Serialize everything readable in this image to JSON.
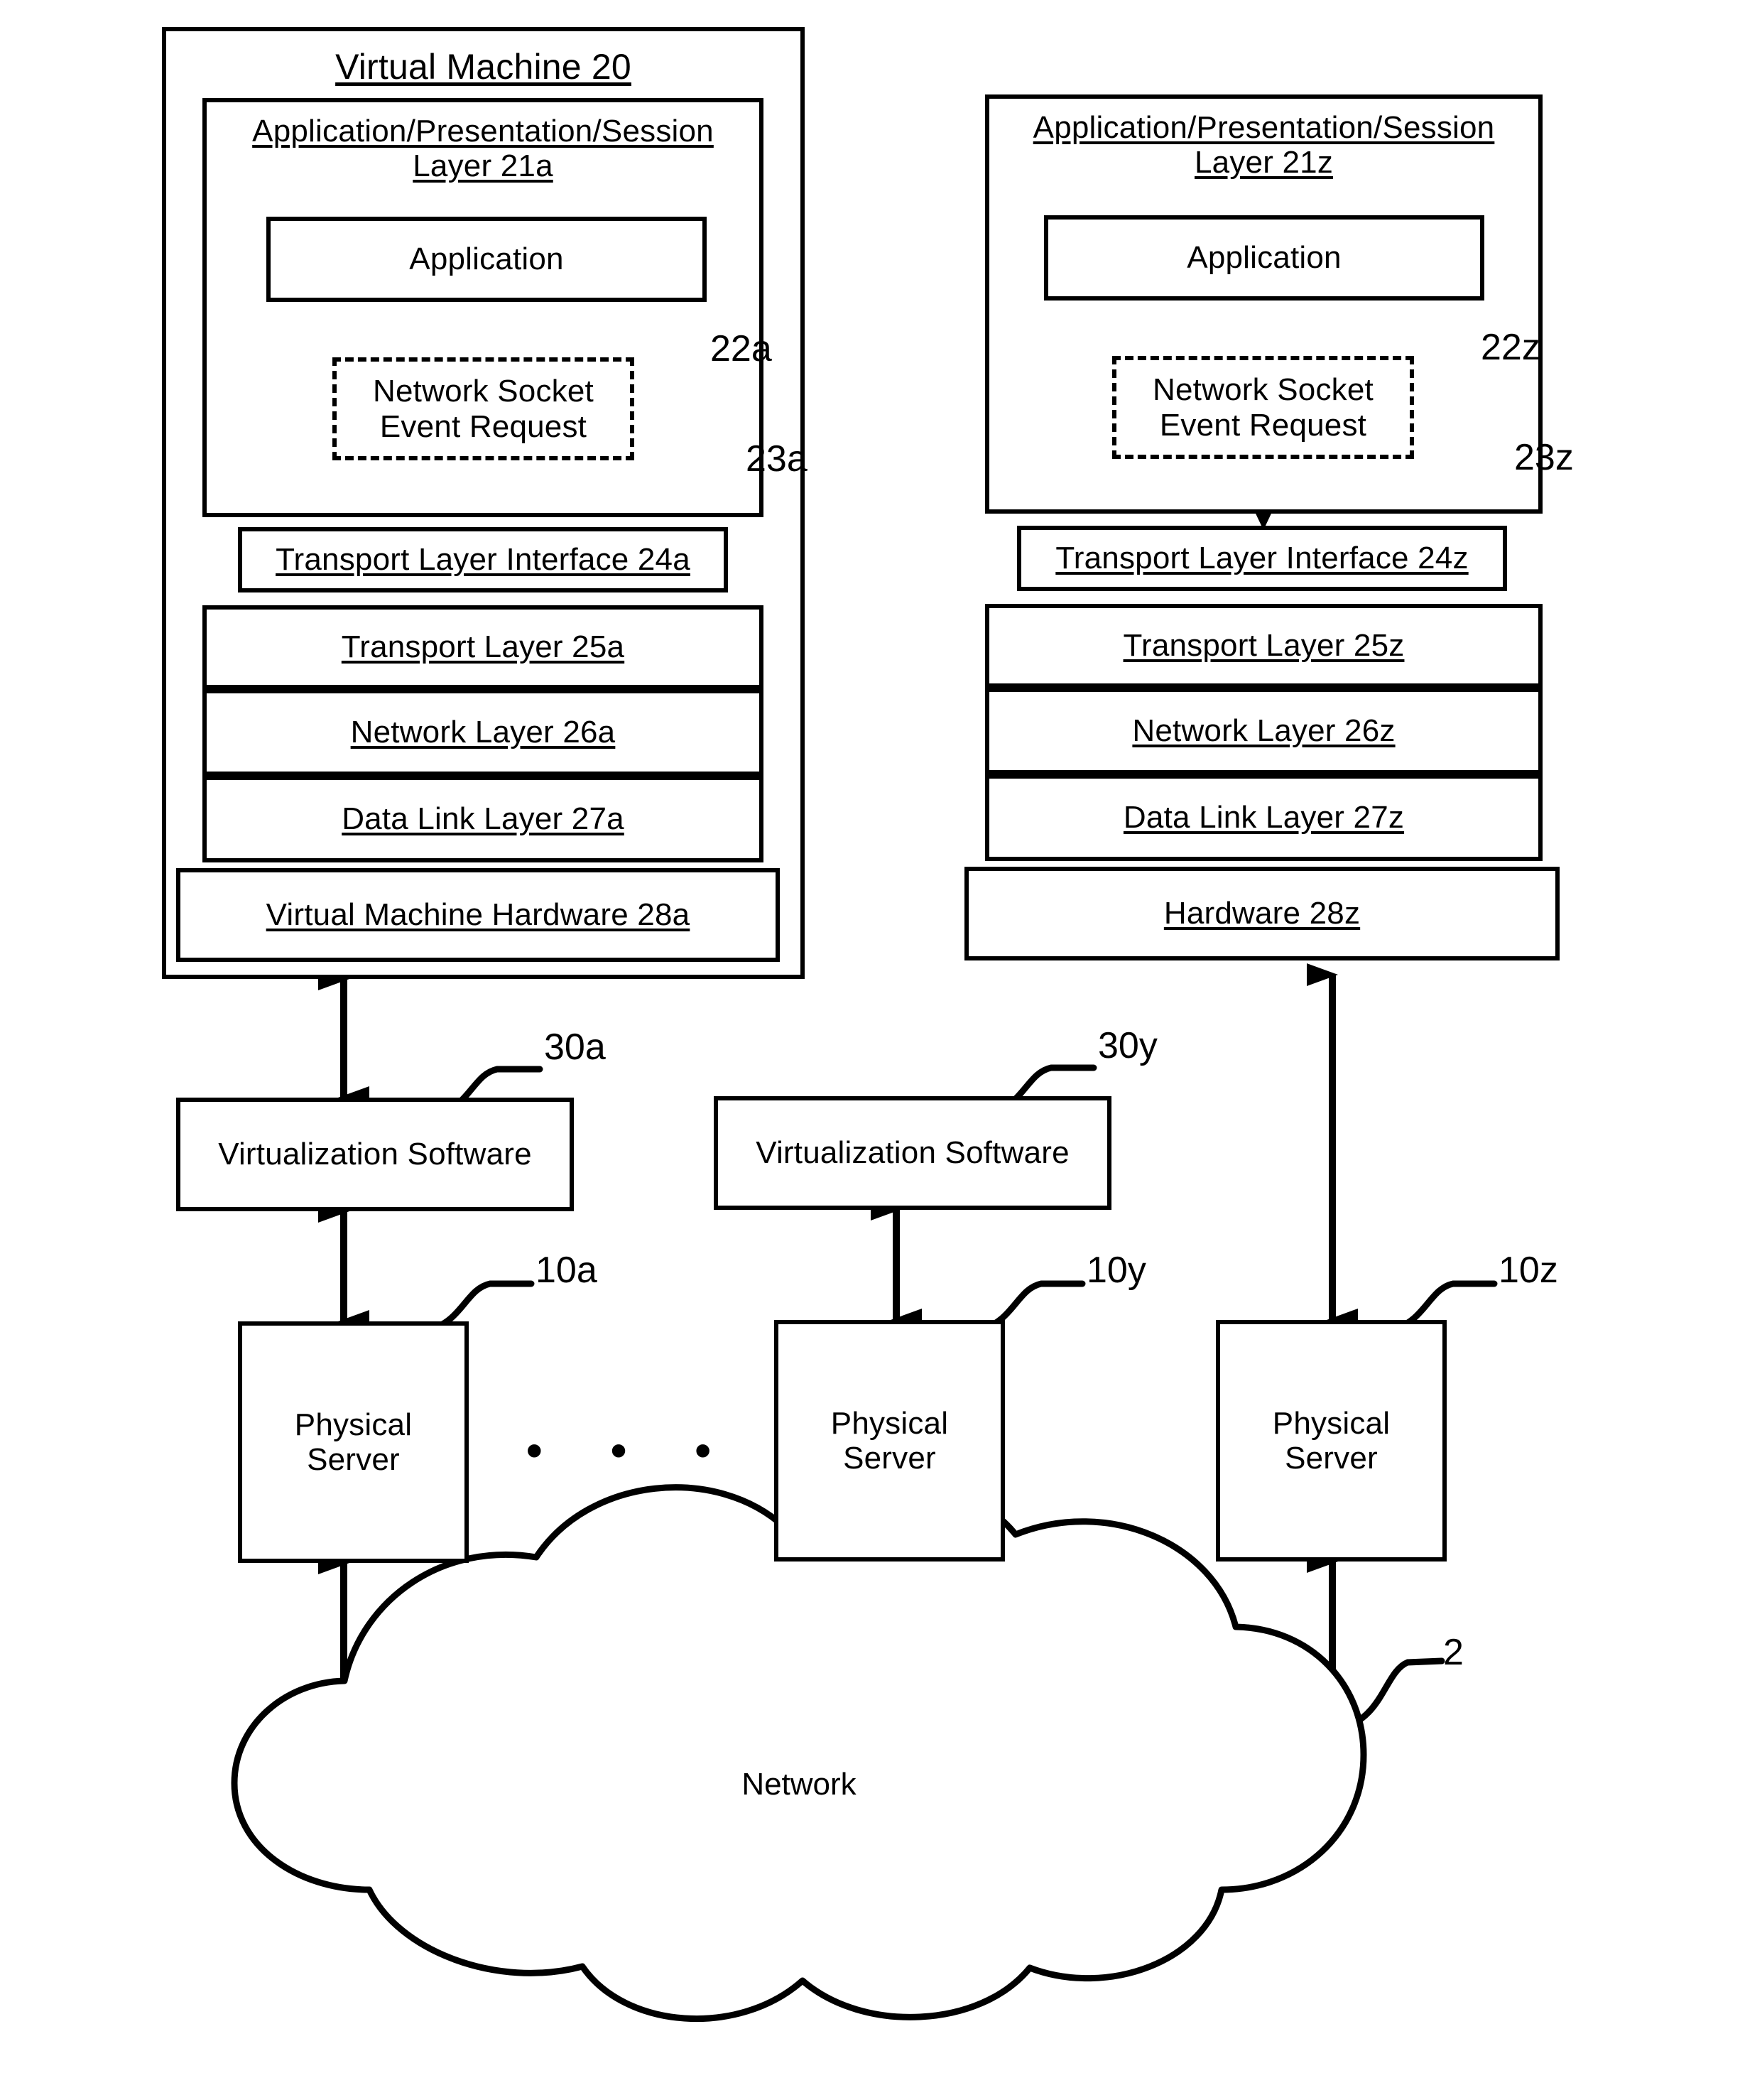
{
  "figure": {
    "title": "Virtual machine network stack and physical server topology"
  },
  "left_stack": {
    "vm_title": "Virtual Machine 20",
    "session_layer": "Application/Presentation/Session\nLayer 21a",
    "application": "Application",
    "socket_request": "Network Socket\nEvent Request",
    "transport_interface": "Transport Layer Interface 24a",
    "transport_layer": "Transport Layer 25a",
    "network_layer": "Network Layer 26a",
    "data_link_layer": "Data Link Layer 27a",
    "hardware": "Virtual Machine Hardware 28a",
    "callout_app": "22a",
    "callout_socket": "23a"
  },
  "right_stack": {
    "session_layer": "Application/Presentation/Session\nLayer 21z",
    "application": "Application",
    "socket_request": "Network Socket\nEvent Request",
    "transport_interface": "Transport Layer Interface 24z",
    "transport_layer": "Transport Layer 25z",
    "network_layer": "Network Layer 26z",
    "data_link_layer": "Data Link Layer 27z",
    "hardware": "Hardware 28z",
    "callout_app": "22z",
    "callout_socket": "23z"
  },
  "virtualization": {
    "left_label": "Virtualization Software",
    "left_callout": "30a",
    "middle_label": "Virtualization Software",
    "middle_callout": "30y"
  },
  "servers": {
    "left_label": "Physical\nServer",
    "left_callout": "10a",
    "middle_label": "Physical\nServer",
    "middle_callout": "10y",
    "right_label": "Physical\nServer",
    "right_callout": "10z",
    "ellipsis": "• • •"
  },
  "network": {
    "label": "Network",
    "callout": "2"
  },
  "colors": {
    "ink": "#000000",
    "paper": "#ffffff"
  }
}
